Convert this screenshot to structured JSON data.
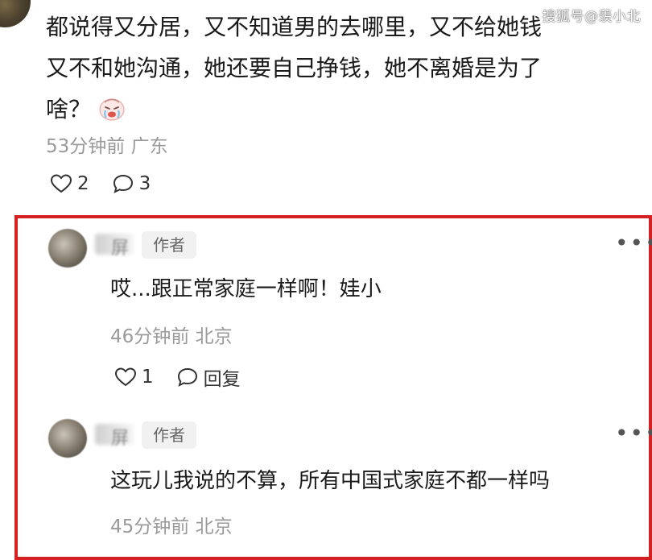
{
  "watermark": "搜狐号@羡小北",
  "comment": {
    "lines": [
      "都说得又分居，又不知道男的去哪里，又不给她钱",
      "又不和她沟通，她还要自己挣钱，她不离婚是为了",
      "啥？"
    ],
    "emoji": "crying-face-emoji",
    "meta": "53分钟前 广东",
    "likes": "2",
    "comments": "3"
  },
  "replies": [
    {
      "name_glyph": "屏",
      "badge": "作者",
      "text": "哎...跟正常家庭一样啊！娃小",
      "meta": "46分钟前 北京",
      "likes": "1",
      "reply_label": "回复"
    },
    {
      "name_glyph": "屏",
      "badge": "作者",
      "text": "这玩儿我说的不算，所有中国式家庭不都一样吗",
      "meta": "45分钟前 北京"
    }
  ],
  "colors": {
    "highlight": "#d41f23",
    "meta": "#9a9a9a",
    "badge_bg": "#f1f1f1"
  }
}
